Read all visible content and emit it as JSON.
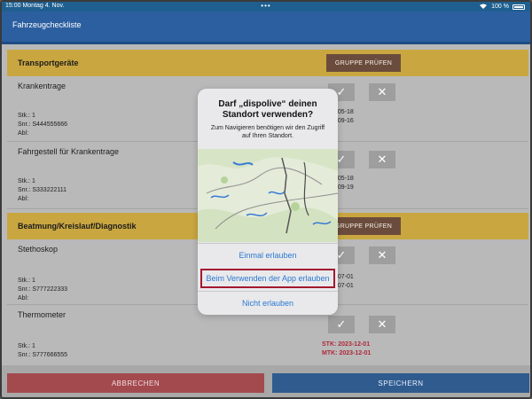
{
  "status_bar": {
    "time_date": "15:00  Montag 4. Nov.",
    "center_dots": "•••",
    "battery": "100 %"
  },
  "header": {
    "title": "Fahrzeugcheckliste"
  },
  "groups": [
    {
      "label": "Transportgeräte",
      "button": "GRUPPE PRÜFEN"
    },
    {
      "label": "Beatmung/Kreislauf/Diagnostik",
      "button": "GRUPPE PRÜFEN"
    }
  ],
  "items": [
    {
      "name": "Krankentrage",
      "stk": "Stk.: 1",
      "snr": "Snr.: S444555666",
      "abl": "Abl:",
      "date1": "2025-05-18",
      "date2": "2025-09-16"
    },
    {
      "name": "Fahrgestell für Krankentrage",
      "stk": "Stk.: 1",
      "snr": "Snr.: S333222111",
      "abl": "Abl:",
      "date1": "2025-05-18",
      "date2": "2025-09-19"
    },
    {
      "name": "Stethoskop",
      "stk": "Stk.: 1",
      "snr": "Snr.: S777222333",
      "abl": "Abl:",
      "date1": "2025-07-01",
      "date2": "2025-07-01"
    },
    {
      "name": "Thermometer",
      "stk": "Stk.: 1",
      "snr": "Snr.: S777666555",
      "abl": "",
      "date1": "STK: 2023-12-01",
      "date2": "MTK: 2023-12-01"
    }
  ],
  "icons": {
    "check": "✓",
    "close": "✕"
  },
  "footer": {
    "cancel": "ABBRECHEN",
    "save": "SPEICHERN"
  },
  "dialog": {
    "title": "Darf „dispolive“ deinen Standort verwenden?",
    "message": "Zum Navigieren benötigen wir den Zugriff auf Ihren Standort.",
    "option_once": "Einmal erlauben",
    "option_while_using": "Beim Verwenden der App erlauben",
    "option_deny": "Nicht erlauben"
  },
  "colors": {
    "group_bar": "#c9a640",
    "group_button": "#6b4c3c",
    "header": "#2c5fa0",
    "cancel": "#a34a4f",
    "save": "#2f5b8f",
    "link": "#2a78d3",
    "highlight": "#a3192f"
  }
}
